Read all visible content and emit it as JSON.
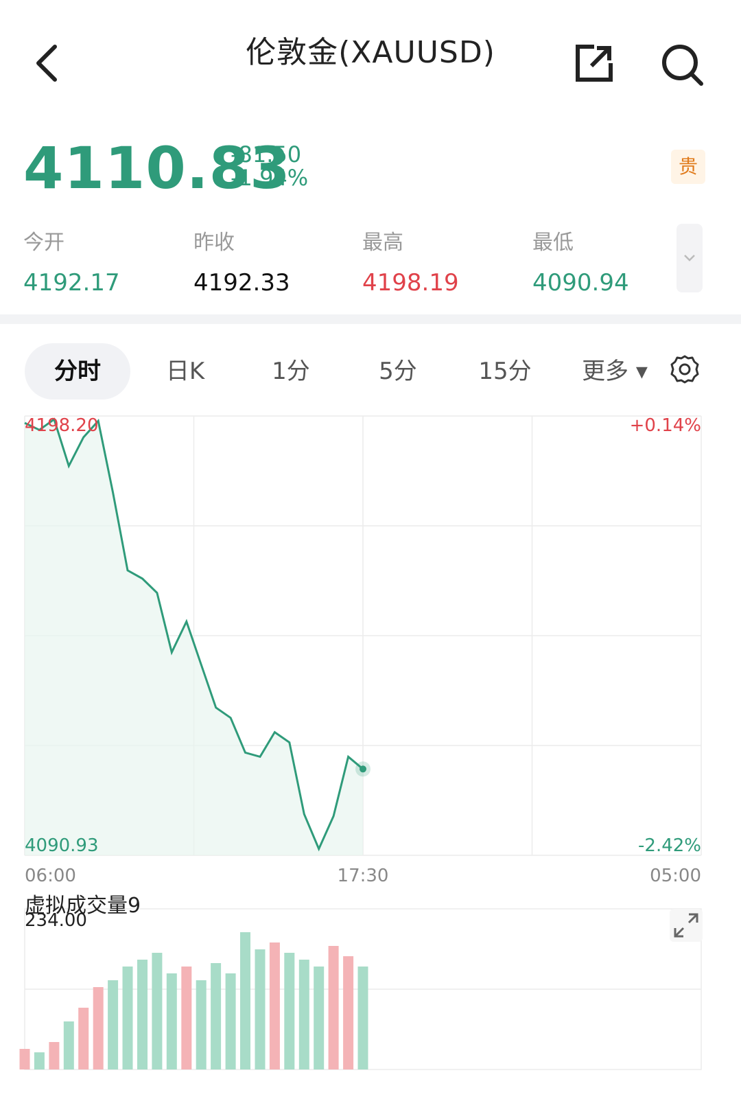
{
  "header": {
    "title": "伦敦金(XAUUSD)",
    "back_icon": "chevron-left-icon",
    "share_icon": "share-external-icon",
    "search_icon": "search-icon"
  },
  "quote": {
    "price": "4110.83",
    "change": "-81.50",
    "change_pct": "-1.94%",
    "tag": "贵",
    "down_color": "#2f9b7a",
    "up_color": "#e0424a"
  },
  "stats": [
    {
      "label": "今开",
      "value": "4192.17",
      "color": "green"
    },
    {
      "label": "昨收",
      "value": "4192.33",
      "color": "black"
    },
    {
      "label": "最高",
      "value": "4198.19",
      "color": "red"
    },
    {
      "label": "最低",
      "value": "4090.94",
      "color": "green"
    }
  ],
  "tabs": [
    {
      "label": "分时",
      "active": true
    },
    {
      "label": "日K",
      "active": false
    },
    {
      "label": "1分",
      "active": false
    },
    {
      "label": "5分",
      "active": false
    },
    {
      "label": "15分",
      "active": false
    },
    {
      "label": "更多 ▾",
      "active": false
    }
  ],
  "chart": {
    "y_max_label": "4198.20",
    "y_min_label": "4090.93",
    "pct_max_label": "+0.14%",
    "pct_min_label": "-2.42%",
    "x_labels": [
      "06:00",
      "17:30",
      "05:00"
    ],
    "volume_title": "虚拟成交量9",
    "volume_max_label": "234.00"
  },
  "chart_data": {
    "type": "line",
    "x": [
      "06:00",
      "06:30",
      "07:00",
      "07:30",
      "08:00",
      "08:30",
      "09:00",
      "09:30",
      "10:00",
      "10:30",
      "11:00",
      "11:30",
      "12:00",
      "12:30",
      "13:00",
      "13:30",
      "14:00",
      "14:30",
      "15:00",
      "15:30",
      "16:00",
      "16:30",
      "17:00",
      "17:30"
    ],
    "y": [
      4196.5,
      4194.8,
      4197.4,
      4186.0,
      4193.0,
      4197.0,
      4179.5,
      4160.5,
      4158.5,
      4155.0,
      4140.5,
      4148.0,
      4137.5,
      4127.0,
      4124.5,
      4116.0,
      4115.0,
      4121.0,
      4118.5,
      4101.0,
      4092.5,
      4100.5,
      4115.0,
      4112.0
    ],
    "ylim": [
      4090.93,
      4198.2
    ],
    "xlim": [
      "06:00",
      "05:00"
    ],
    "volume": [
      30,
      25,
      40,
      70,
      90,
      120,
      130,
      150,
      160,
      170,
      140,
      150,
      130,
      155,
      140,
      200,
      175,
      185,
      170,
      160,
      150,
      180,
      165,
      150
    ],
    "volume_max": 234.0
  }
}
